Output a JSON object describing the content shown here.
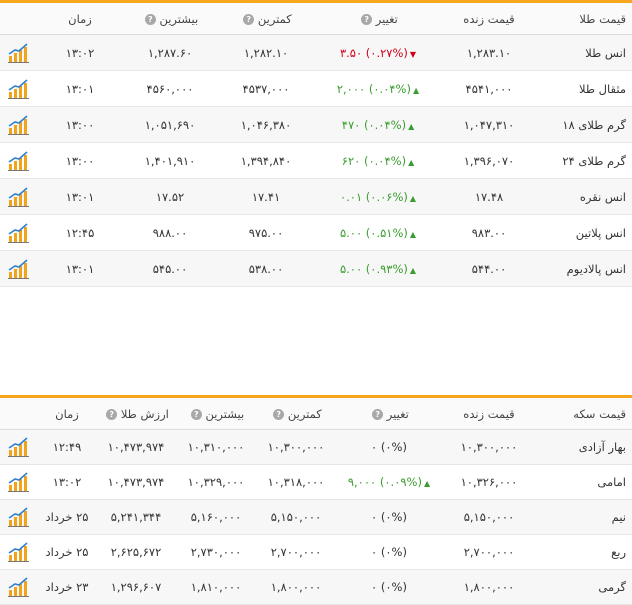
{
  "gold": {
    "headers": {
      "name": "قیمت طلا",
      "live": "قیمت زنده",
      "change": "تغییر",
      "low": "کمترین",
      "high": "بیشترین",
      "time": "زمان"
    },
    "rows": [
      {
        "name": "انس طلا",
        "live": "۱,۲۸۳.۱۰",
        "change_pct": "(۰.۲۷%)",
        "change_val": "۳.۵۰",
        "dir": "down",
        "low": "۱,۲۸۲.۱۰",
        "high": "۱,۲۸۷.۶۰",
        "time": "۱۳:۰۲"
      },
      {
        "name": "مثقال طلا",
        "live": "۴۵۴۱,۰۰۰",
        "change_pct": "(۰.۰۴%)",
        "change_val": "۲,۰۰۰",
        "dir": "up",
        "low": "۴۵۳۷,۰۰۰",
        "high": "۴۵۶۰,۰۰۰",
        "time": "۱۳:۰۱"
      },
      {
        "name": "گرم طلای ۱۸",
        "live": "۱,۰۴۷,۳۱۰",
        "change_pct": "(۰.۰۴%)",
        "change_val": "۴۷۰",
        "dir": "up",
        "low": "۱,۰۴۶,۳۸۰",
        "high": "۱,۰۵۱,۶۹۰",
        "time": "۱۳:۰۰"
      },
      {
        "name": "گرم طلای ۲۴",
        "live": "۱,۳۹۶,۰۷۰",
        "change_pct": "(۰.۰۴%)",
        "change_val": "۶۲۰",
        "dir": "up",
        "low": "۱,۳۹۴,۸۴۰",
        "high": "۱,۴۰۱,۹۱۰",
        "time": "۱۳:۰۰"
      },
      {
        "name": "انس نقره",
        "live": "۱۷.۴۸",
        "change_pct": "(۰.۰۶%)",
        "change_val": "۰.۰۱",
        "dir": "up",
        "low": "۱۷.۴۱",
        "high": "۱۷.۵۲",
        "time": "۱۳:۰۱"
      },
      {
        "name": "انس پلاتین",
        "live": "۹۸۳.۰۰",
        "change_pct": "(۰.۵۱%)",
        "change_val": "۵.۰۰",
        "dir": "up",
        "low": "۹۷۵.۰۰",
        "high": "۹۸۸.۰۰",
        "time": "۱۲:۴۵"
      },
      {
        "name": "انس پالادیوم",
        "live": "۵۴۴.۰۰",
        "change_pct": "(۰.۹۳%)",
        "change_val": "۵.۰۰",
        "dir": "up",
        "low": "۵۳۸.۰۰",
        "high": "۵۴۵.۰۰",
        "time": "۱۳:۰۱"
      }
    ]
  },
  "coin": {
    "headers": {
      "name": "قیمت سکه",
      "live": "قیمت زنده",
      "change": "تغییر",
      "low": "کمترین",
      "high": "بیشترین",
      "value": "ارزش طلا",
      "time": "زمان"
    },
    "rows": [
      {
        "name": "بهار آزادی",
        "live": "۱۰,۳۰۰,۰۰۰",
        "change_pct": "(۰%)",
        "change_val": "۰",
        "dir": "none",
        "low": "۱۰,۳۰۰,۰۰۰",
        "high": "۱۰,۳۱۰,۰۰۰",
        "value": "۱۰,۴۷۳,۹۷۴",
        "time": "۱۲:۴۹"
      },
      {
        "name": "امامی",
        "live": "۱۰,۳۲۶,۰۰۰",
        "change_pct": "(۰.۰۹%)",
        "change_val": "۹,۰۰۰",
        "dir": "up",
        "low": "۱۰,۳۱۸,۰۰۰",
        "high": "۱۰,۳۲۹,۰۰۰",
        "value": "۱۰,۴۷۳,۹۷۴",
        "time": "۱۳:۰۲"
      },
      {
        "name": "نیم",
        "live": "۵,۱۵۰,۰۰۰",
        "change_pct": "(۰%)",
        "change_val": "۰",
        "dir": "none",
        "low": "۵,۱۵۰,۰۰۰",
        "high": "۵,۱۶۰,۰۰۰",
        "value": "۵,۲۴۱,۳۴۴",
        "time": "۲۵ خرداد"
      },
      {
        "name": "ربع",
        "live": "۲,۷۰۰,۰۰۰",
        "change_pct": "(۰%)",
        "change_val": "۰",
        "dir": "none",
        "low": "۲,۷۰۰,۰۰۰",
        "high": "۲,۷۳۰,۰۰۰",
        "value": "۲,۶۲۵,۶۷۲",
        "time": "۲۵ خرداد"
      },
      {
        "name": "گرمی",
        "live": "۱,۸۰۰,۰۰۰",
        "change_pct": "(۰%)",
        "change_val": "۰",
        "dir": "none",
        "low": "۱,۸۰۰,۰۰۰",
        "high": "۱,۸۱۰,۰۰۰",
        "value": "۱,۲۹۶,۶۰۷",
        "time": "۲۳ خرداد"
      }
    ]
  },
  "icons": {
    "help": "question-circle-icon",
    "chart": "bar-chart-icon",
    "up": "triangle-up-icon",
    "down": "triangle-down-icon"
  },
  "colors": {
    "accent": "#f7a51c",
    "positive": "#3a9d2f",
    "negative": "#d0021b",
    "help_badge": "#a8a8a8"
  }
}
